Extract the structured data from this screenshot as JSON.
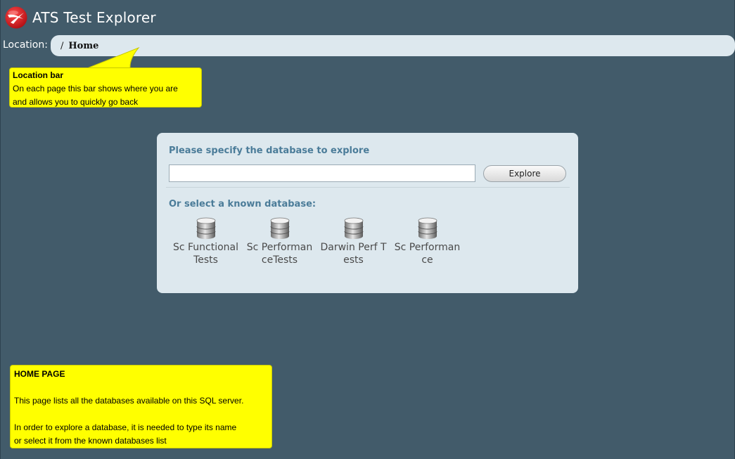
{
  "app": {
    "title": "ATS Test Explorer",
    "logo_icon": "ats-logo-icon"
  },
  "location": {
    "label": "Location:",
    "separator": "/",
    "current": "Home"
  },
  "explore": {
    "heading": "Please specify the database to explore",
    "input_value": "",
    "button_label": "Explore",
    "known_heading": "Or select a known database:",
    "databases": [
      {
        "label": "Sc Functional Tests",
        "icon": "database-icon"
      },
      {
        "label": "Sc PerformanceTests",
        "icon": "database-icon"
      },
      {
        "label": "Darwin Perf Tests",
        "icon": "database-icon"
      },
      {
        "label": "Sc Performance",
        "icon": "database-icon"
      }
    ]
  },
  "callouts": {
    "location_bar": {
      "title": "Location bar",
      "line1": "On each page this bar shows where you are",
      "line2": "and allows you to quickly go back"
    },
    "home_page": {
      "title": "HOME PAGE",
      "paragraph1": "This page lists all the databases available on this SQL server.",
      "paragraph2_line1": "In order to explore a database, it is needed to type its name",
      "paragraph2_line2": "or select it from the known databases list"
    }
  },
  "colors": {
    "background": "#425b6a",
    "panel": "#dde8ee",
    "heading": "#4b7c99",
    "callout": "#ffff00",
    "logo_red": "#d8171d"
  }
}
